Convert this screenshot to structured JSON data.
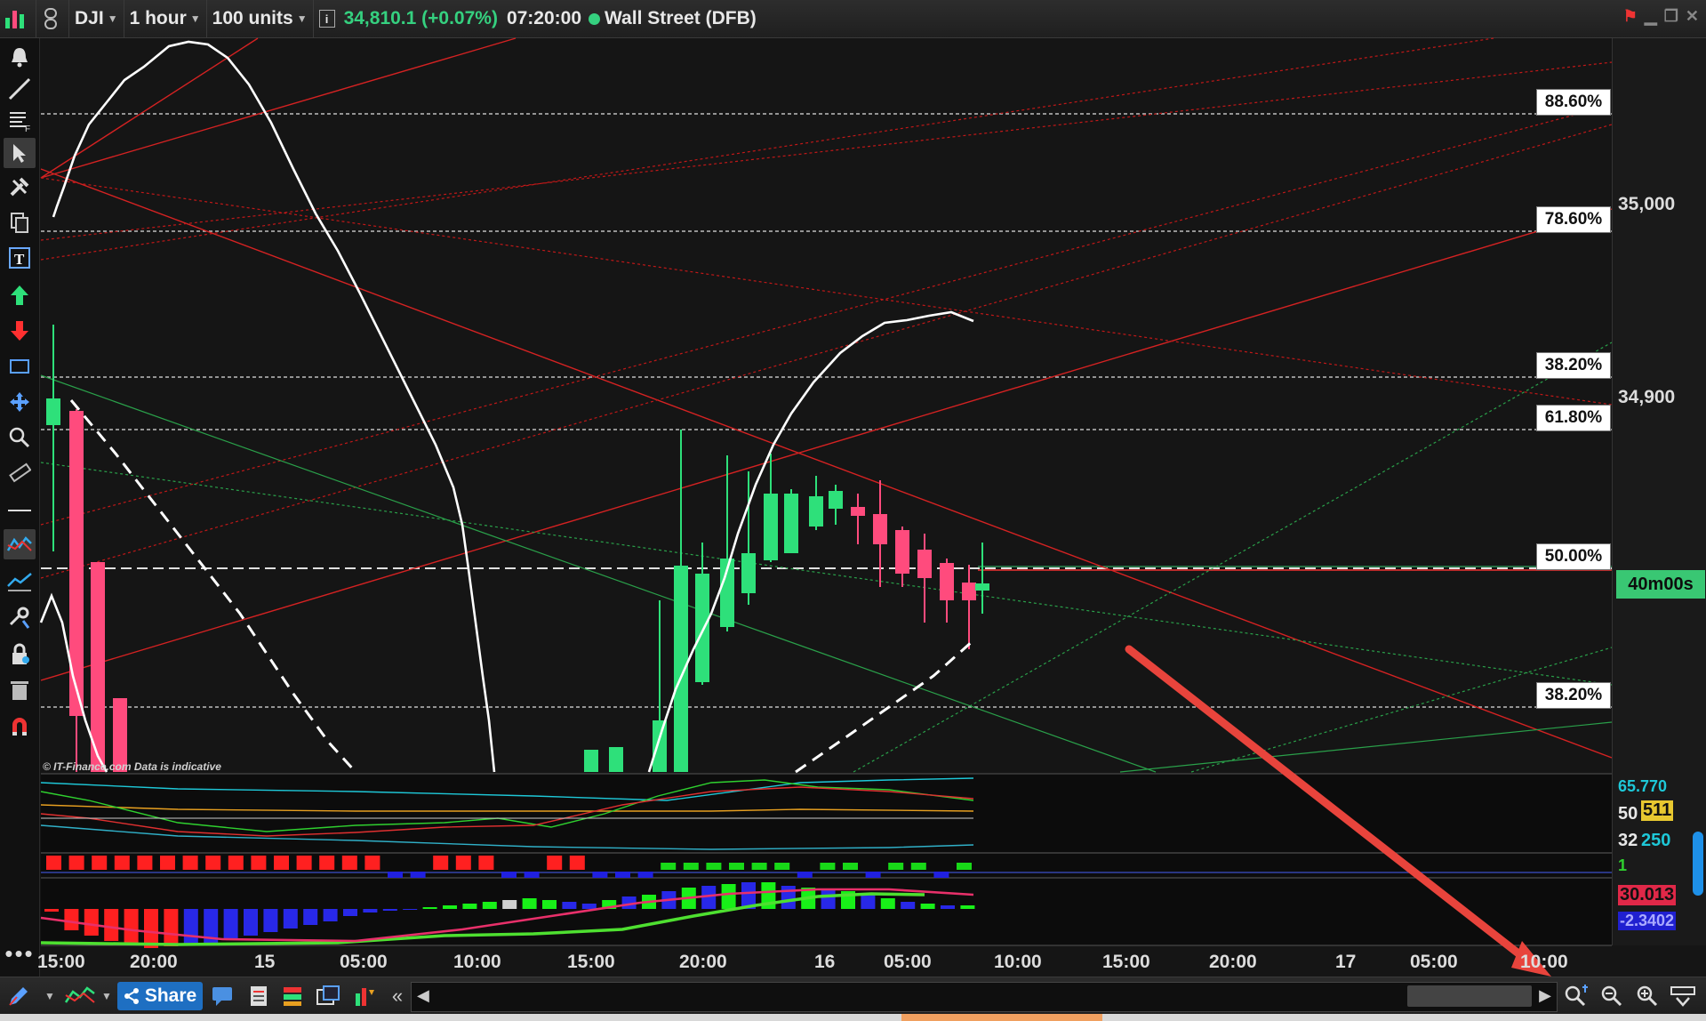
{
  "header": {
    "symbol": "DJI",
    "timeframe": "1 hour",
    "units": "100 units",
    "info_icon": "info-icon",
    "price_change": "34,810.1 (+0.07%)",
    "time": "07:20:00",
    "market": "Wall Street (DFB)",
    "status_color": "#35d07f"
  },
  "chart": {
    "y_ticks": [
      "35,000",
      "34,900"
    ],
    "fib_levels": [
      "88.60%",
      "78.60%",
      "38.20%",
      "61.80%",
      "50.00%",
      "38.20%"
    ],
    "countdown": "40m00s",
    "watermark": "© IT-Finance.com  Data is indicative",
    "x_ticks": [
      "15:00",
      "20:00",
      "15",
      "05:00",
      "10:00",
      "15:00",
      "20:00",
      "16",
      "05:00",
      "10:00",
      "15:00",
      "20:00",
      "17",
      "05:00",
      "10:00"
    ],
    "up_color": "#2ee07a",
    "down_color": "#ff4b7d"
  },
  "indicators": {
    "panel1": {
      "v1": "65.770",
      "v2": "50",
      "v3": "511",
      "v4": "32",
      "v5": "250"
    },
    "panel2": {
      "v1": "1"
    },
    "panel3": {
      "v1": "30.013",
      "v2": "0",
      "v3": "-2.3402"
    }
  },
  "toolbar_left": [
    "bar-chart-icon",
    "bell-icon",
    "trendline-icon",
    "text-style-icon",
    "pointer-icon",
    "tools-icon",
    "copy-icon",
    "text-icon",
    "buy-arrow-icon",
    "sell-arrow-icon",
    "rectangle-icon",
    "move-icon",
    "zoom-icon",
    "ruler-icon",
    "line-icon",
    "indicator-icon",
    "oscillator-icon",
    "settings-icon",
    "lock-icon",
    "trash-icon",
    "magnet-icon",
    "more-icon"
  ],
  "bottom": {
    "share_label": "Share"
  }
}
